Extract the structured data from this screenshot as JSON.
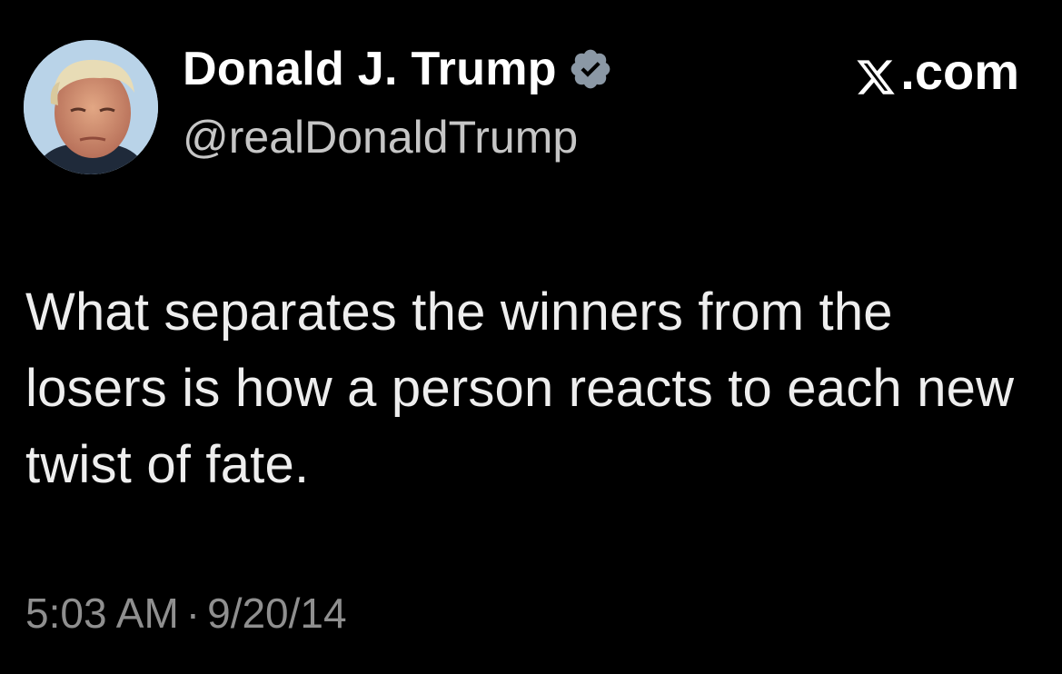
{
  "author": {
    "display_name": "Donald J. Trump",
    "handle": "@realDonaldTrump",
    "avatar_icon": "profile-photo",
    "verified_icon": "verified-badge-icon",
    "verified_color": "#8b98a5"
  },
  "source": {
    "logo_letter": "𝕏",
    "domain": ".com"
  },
  "tweet": {
    "text": "What separates the winners from the losers is how a person reacts to each new twist of fate."
  },
  "meta": {
    "time": "5:03 AM",
    "separator": "·",
    "date": "9/20/14"
  },
  "colors": {
    "background": "#000000",
    "primary_text": "#ffffff",
    "secondary_text": "#8f8f8f"
  }
}
